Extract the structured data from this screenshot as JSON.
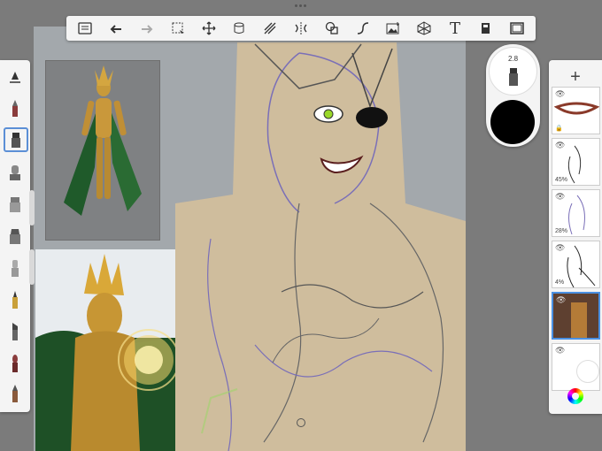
{
  "toolbar": {
    "items": [
      "layers-list",
      "undo",
      "redo",
      "selection",
      "transform",
      "ruler",
      "perspective-guide",
      "symmetry",
      "shape",
      "curve-tool",
      "image-import",
      "grid",
      "text",
      "fill",
      "fullscreen"
    ],
    "text_glyph": "T"
  },
  "brush": {
    "size": "2.8",
    "color": "#000000"
  },
  "layers": {
    "add_label": "+",
    "items": [
      {
        "opacity": "",
        "visible": true
      },
      {
        "opacity": "45%",
        "visible": true
      },
      {
        "opacity": "28%",
        "visible": true
      },
      {
        "opacity": "4%",
        "visible": true
      },
      {
        "opacity": "",
        "visible": true,
        "active": true
      },
      {
        "opacity": "",
        "visible": true
      }
    ]
  },
  "colors": {
    "accent": "#4a90e2",
    "panel": "#f4f4f4",
    "background": "#7b7b7b",
    "canvas": "#a3a8ac"
  }
}
